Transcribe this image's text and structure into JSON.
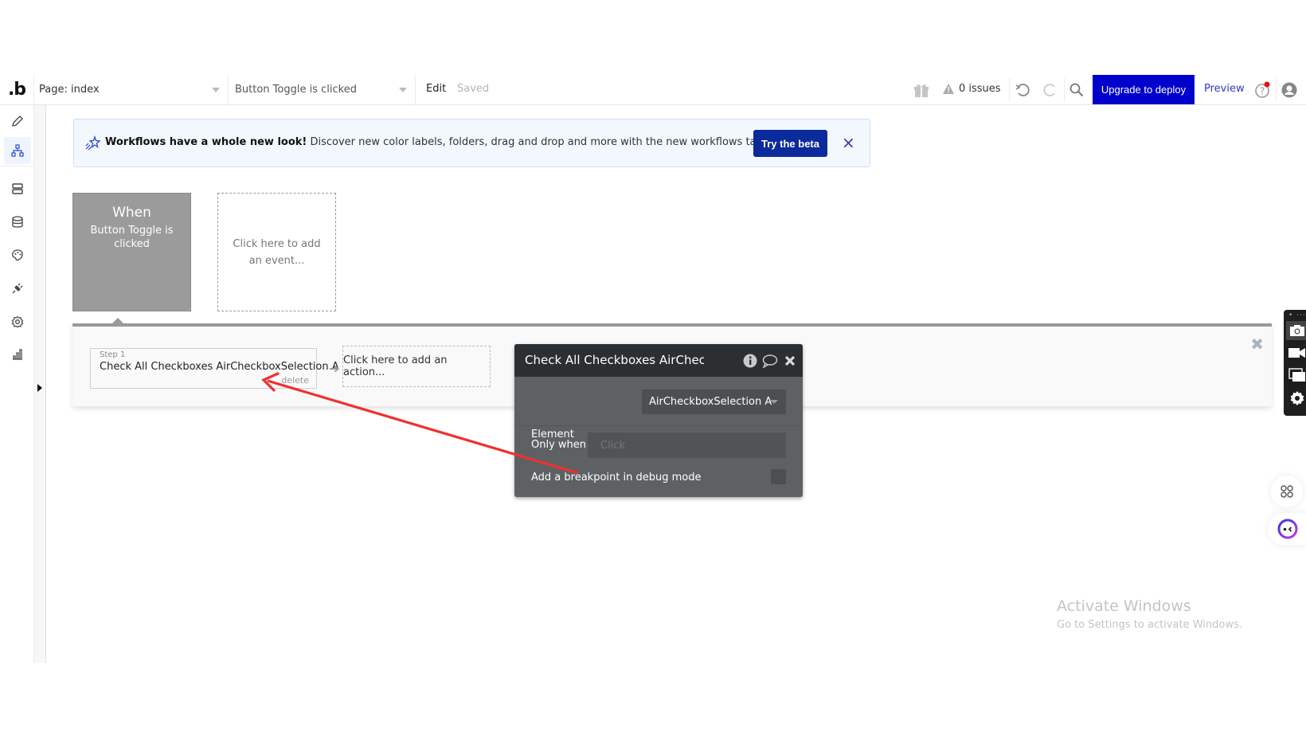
{
  "topbar": {
    "logo": ".b",
    "page_dropdown": "Page: index",
    "event_dropdown": "Button Toggle is clicked",
    "edit_label": "Edit",
    "save_status": "Saved",
    "issues": "0 issues",
    "upgrade_button": "Upgrade to deploy",
    "preview_link": "Preview",
    "icons": [
      "gift-icon",
      "warning-icon",
      "undo-icon",
      "redo-icon",
      "search-icon",
      "help-icon",
      "user-avatar-icon"
    ]
  },
  "sidebar": {
    "items": [
      {
        "name": "design",
        "icon": "pencil-icon",
        "active": false
      },
      {
        "name": "workflow",
        "icon": "workflow-icon",
        "active": true
      },
      {
        "name": "data",
        "icon": "data-icon",
        "active": false
      },
      {
        "name": "database",
        "icon": "database-icon",
        "active": false
      },
      {
        "name": "styles",
        "icon": "palette-icon",
        "active": false
      },
      {
        "name": "plugins",
        "icon": "plug-icon",
        "active": false
      },
      {
        "name": "settings",
        "icon": "gear-icon",
        "active": false
      },
      {
        "name": "logs",
        "icon": "bar-chart-icon",
        "active": false
      }
    ]
  },
  "banner": {
    "headline": "Workflows have a whole new look!",
    "body": " Discover new color labels, folders, drag and drop and more with the new workflows tab design.",
    "button": "Try the beta",
    "close": "×"
  },
  "events": {
    "when_title": "When",
    "when_event": "Button Toggle is clicked",
    "add_event": "Click here to add an event..."
  },
  "actions": {
    "step_label": "Step 1",
    "step_title": "Check All Checkboxes AirCheckboxSelection A",
    "delete_label": "delete",
    "add_action": "Click here to add an action..."
  },
  "property_editor": {
    "title": "Check All Checkboxes AirCheckt",
    "element_label": "Element",
    "element_value": "AirCheckboxSelection A",
    "only_when_label": "Only when",
    "only_when_placeholder": "Click",
    "breakpoint_label": "Add a breakpoint in debug mode",
    "breakpoint_checked": false
  },
  "watermark": {
    "title": "Activate Windows",
    "subtitle": "Go to Settings to activate Windows."
  },
  "colors": {
    "accent": "#0000cc",
    "beta_button": "#0b2a9c",
    "annotation_arrow": "#f03030",
    "panel_dark": "#2c2f31",
    "panel_body": "#5e6163"
  }
}
